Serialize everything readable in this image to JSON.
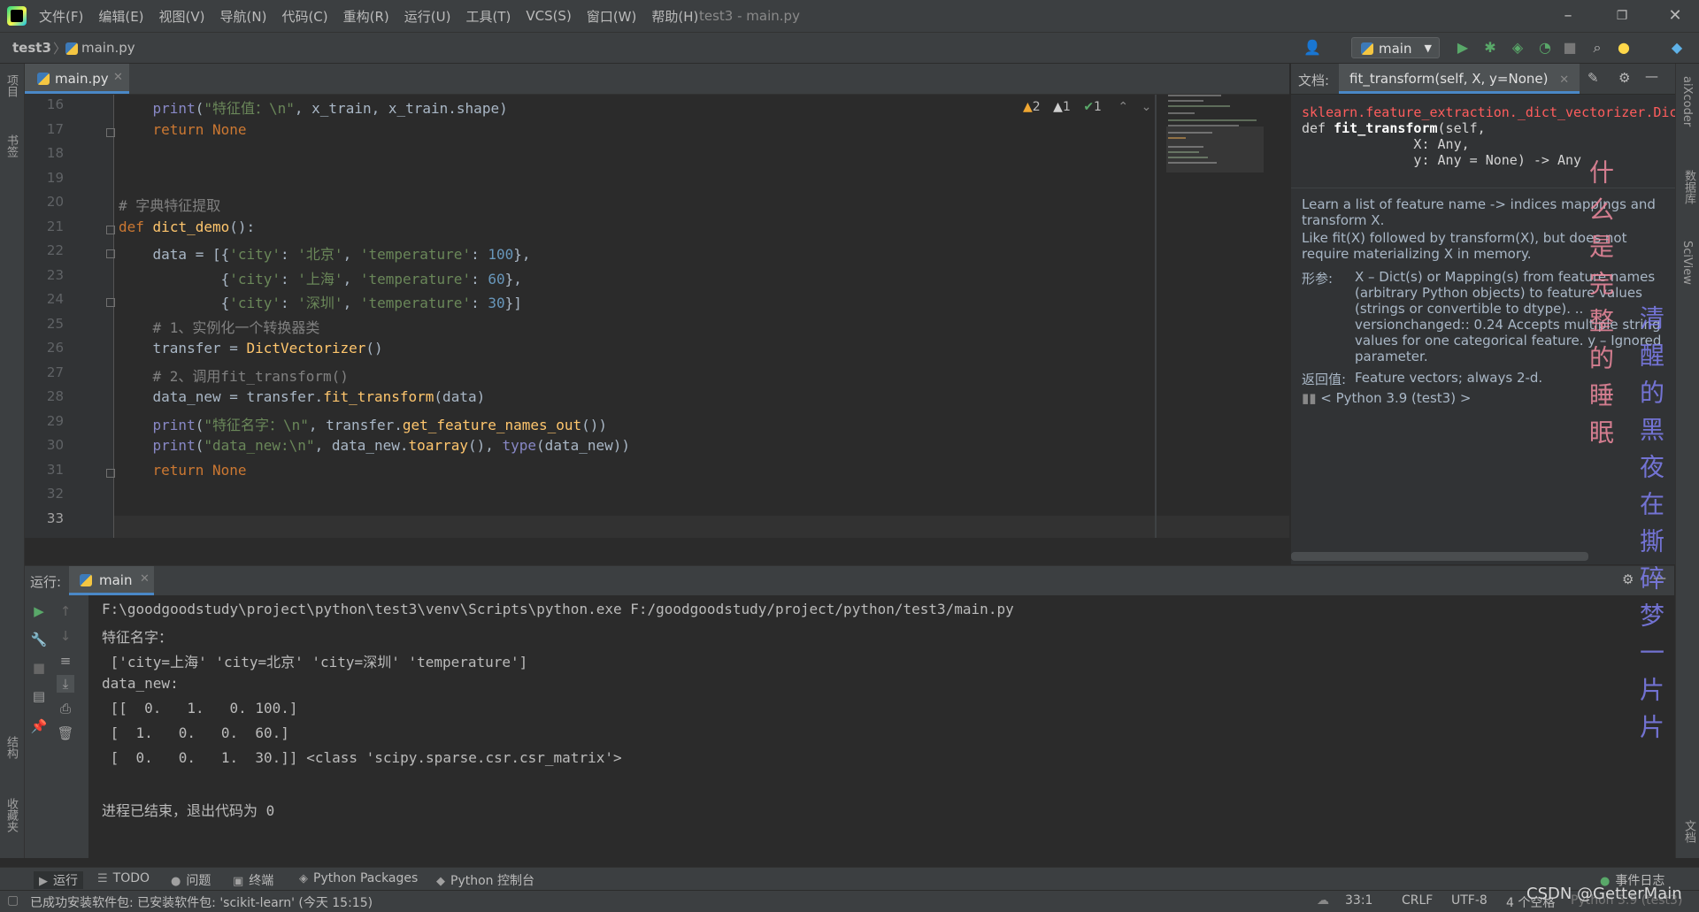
{
  "window": {
    "title": "test3 - main.py",
    "menu": [
      "文件(F)",
      "编辑(E)",
      "视图(V)",
      "导航(N)",
      "代码(C)",
      "重构(R)",
      "运行(U)",
      "工具(T)",
      "VCS(S)",
      "窗口(W)",
      "帮助(H)"
    ]
  },
  "nav": {
    "project": "test3",
    "file": "main.py",
    "run_config": "main"
  },
  "left_strip": {
    "project_label": "项目",
    "bookmarks_label": "书签",
    "structure_label": "结构",
    "favorites_label": "收藏夹"
  },
  "right_strip": {
    "aixcoder_label": "aiXcoder",
    "database_label": "数据库",
    "sciview_label": "SciView",
    "docs_label": "文档"
  },
  "editor": {
    "tab": "main.py",
    "inspection": {
      "warn": "2",
      "weak": "1",
      "ok": "1"
    },
    "lines": [
      {
        "n": "16",
        "html": "    <span class=\"bi\">print</span>(<span class=\"str\">\"特征值：\\n\"</span>, x_train, x_train.shape)"
      },
      {
        "n": "17",
        "html": "    <span class=\"kw\">return</span> <span class=\"kw\">None</span>"
      },
      {
        "n": "18",
        "html": ""
      },
      {
        "n": "19",
        "html": ""
      },
      {
        "n": "20",
        "html": "<span class=\"cmt\"># 字典特征提取</span>"
      },
      {
        "n": "21",
        "html": "<span class=\"kw\">def</span> <span class=\"fn\">dict_demo</span>():"
      },
      {
        "n": "22",
        "html": "    data = [{<span class=\"str\">'city'</span>: <span class=\"str\">'北京'</span>, <span class=\"str\">'temperature'</span>: <span class=\"num\">100</span>},"
      },
      {
        "n": "23",
        "html": "            {<span class=\"str\">'city'</span>: <span class=\"str\">'上海'</span>, <span class=\"str\">'temperature'</span>: <span class=\"num\">60</span>},"
      },
      {
        "n": "24",
        "html": "            {<span class=\"str\">'city'</span>: <span class=\"str\">'深圳'</span>, <span class=\"str\">'temperature'</span>: <span class=\"num\">30</span>}]"
      },
      {
        "n": "25",
        "html": "    <span class=\"cmt\"># 1、实例化一个转换器类</span>"
      },
      {
        "n": "26",
        "html": "    transfer = <span class=\"fn\">DictVectorizer</span>()"
      },
      {
        "n": "27",
        "html": "    <span class=\"cmt\"># 2、调用fit_transform()</span>"
      },
      {
        "n": "28",
        "html": "    data_new = transfer.<span class=\"fn\">fit_transform</span>(data)"
      },
      {
        "n": "29",
        "html": "    <span class=\"bi\">print</span>(<span class=\"str\">\"特征名字：\\n\"</span>, transfer.<span class=\"fn\">get_feature_names_out</span>())"
      },
      {
        "n": "30",
        "html": "    <span class=\"bi\">print</span>(<span class=\"str\">\"data_new:\\n\"</span>, data_new.<span class=\"fn\">toarray</span>(), <span class=\"bi\">type</span>(data_new))"
      },
      {
        "n": "31",
        "html": "    <span class=\"kw\">return</span> <span class=\"kw\">None</span>"
      },
      {
        "n": "32",
        "html": ""
      },
      {
        "n": "33",
        "html": ""
      }
    ]
  },
  "doc": {
    "label": "文档:",
    "tab": "fit_transform(self, X, y=None)",
    "module": "sklearn.feature_extraction._dict_vectorizer.Dic",
    "sig_def": "def ",
    "sig_name": "fit_transform",
    "sig_rest": "(self,\n              X: Any,\n              y: Any = None) -> Any",
    "p1": "Learn a list of feature name -> indices mappings and transform X.",
    "p2": "Like fit(X) followed by transform(X), but does not require materializing X in memory.",
    "params_label": "形参:",
    "params_text": "X – Dict(s) or Mapping(s) from feature names (arbitrary Python objects) to feature values (strings or convertible to dtype). .. versionchanged:: 0.24 Accepts multiple string values for one categorical feature. y – Ignored parameter.",
    "returns_label": "返回值:",
    "returns_text": "Feature vectors; always 2-d.",
    "env": "< Python 3.9 (test3) >"
  },
  "run": {
    "label": "运行:",
    "tab": "main",
    "console": [
      "F:\\goodgoodstudy\\project\\python\\test3\\venv\\Scripts\\python.exe F:/goodgoodstudy/project/python/test3/main.py",
      "特征名字：",
      " ['city=上海' 'city=北京' 'city=深圳' 'temperature']",
      "data_new:",
      " [[  0.   1.   0. 100.]",
      " [  1.   0.   0.  60.]",
      " [  0.   0.   1.  30.]] <class 'scipy.sparse.csr.csr_matrix'>",
      "",
      "进程已结束，退出代码为 0"
    ]
  },
  "tool_tabs": [
    "运行",
    "TODO",
    "问题",
    "终端",
    "Python Packages",
    "Python 控制台"
  ],
  "event_log": "事件日志",
  "status": {
    "message": "已成功安装软件包: 已安装软件包: 'scikit-learn' (今天 15:15)",
    "position": "33:1",
    "line_sep": "CRLF",
    "encoding": "UTF-8",
    "indent": "4 个空格",
    "interpreter": "Python 3.9 (test3)"
  },
  "overlay": {
    "col1": "什么是完整的睡眠",
    "col2": "清醒的黑夜在撕碎梦一片片",
    "watermark": "CSDN @GetterMain"
  },
  "colors": {
    "accent": "#4a88c7",
    "run_green": "#59a869",
    "warning": "#f0a732"
  }
}
